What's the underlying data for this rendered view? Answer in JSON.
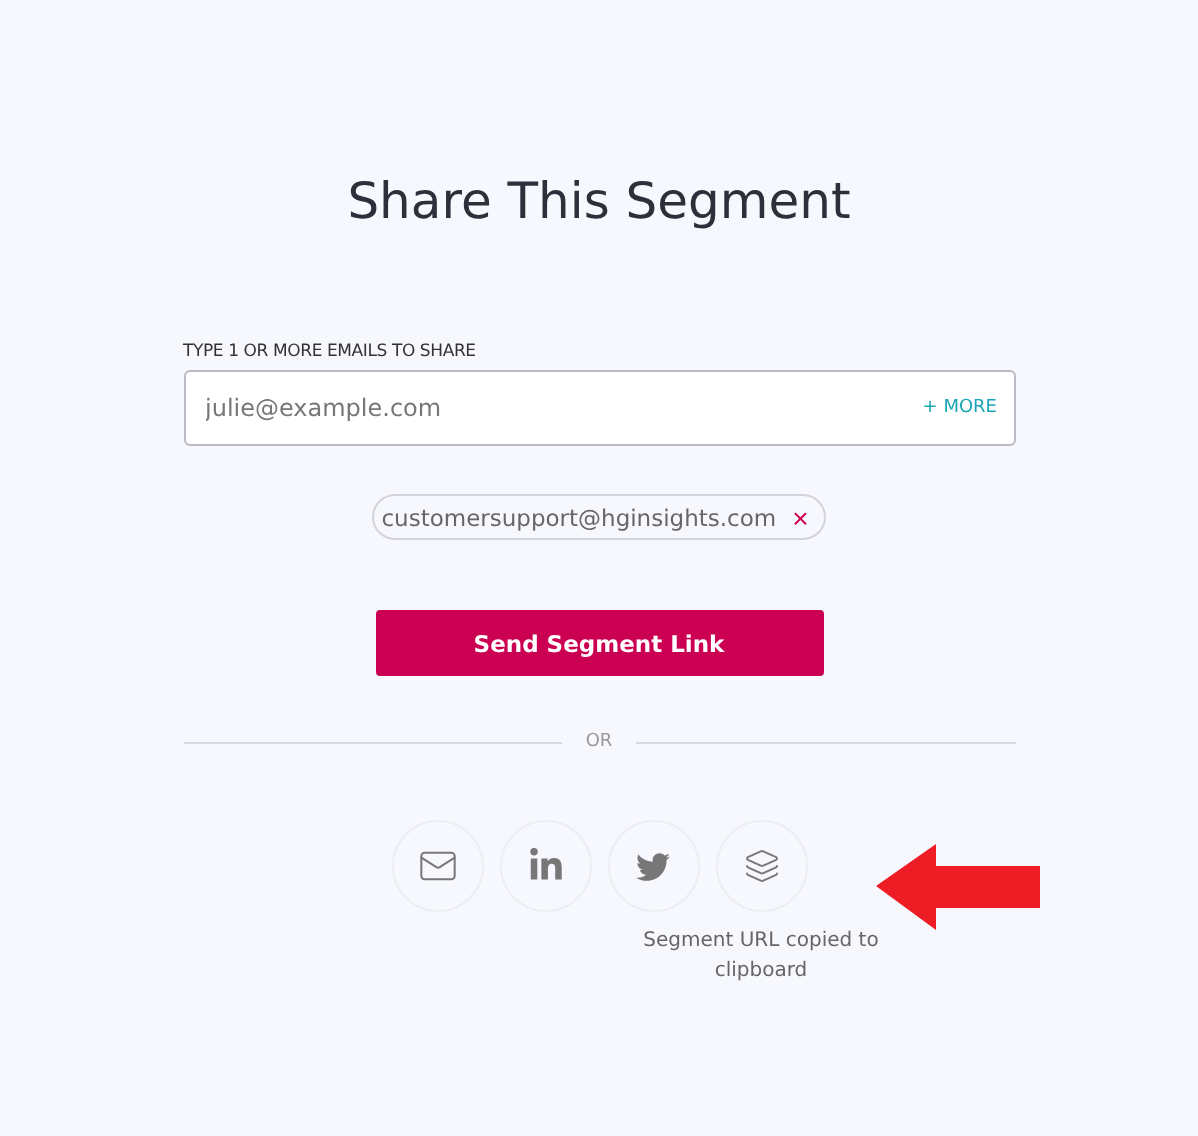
{
  "title": "Share This Segment",
  "email_field": {
    "label": "TYPE 1 OR MORE EMAILS TO SHARE",
    "placeholder": "julie@example.com",
    "more_button": "+ MORE"
  },
  "recipients": [
    {
      "email": "customersupport@hginsights.com",
      "remove": "×"
    }
  ],
  "send_button": "Send Segment Link",
  "divider_text": "OR",
  "share_buttons": [
    {
      "kind": "email"
    },
    {
      "kind": "linkedin"
    },
    {
      "kind": "twitter"
    },
    {
      "kind": "copy",
      "message": "Segment URL copied to clipboard"
    }
  ]
}
